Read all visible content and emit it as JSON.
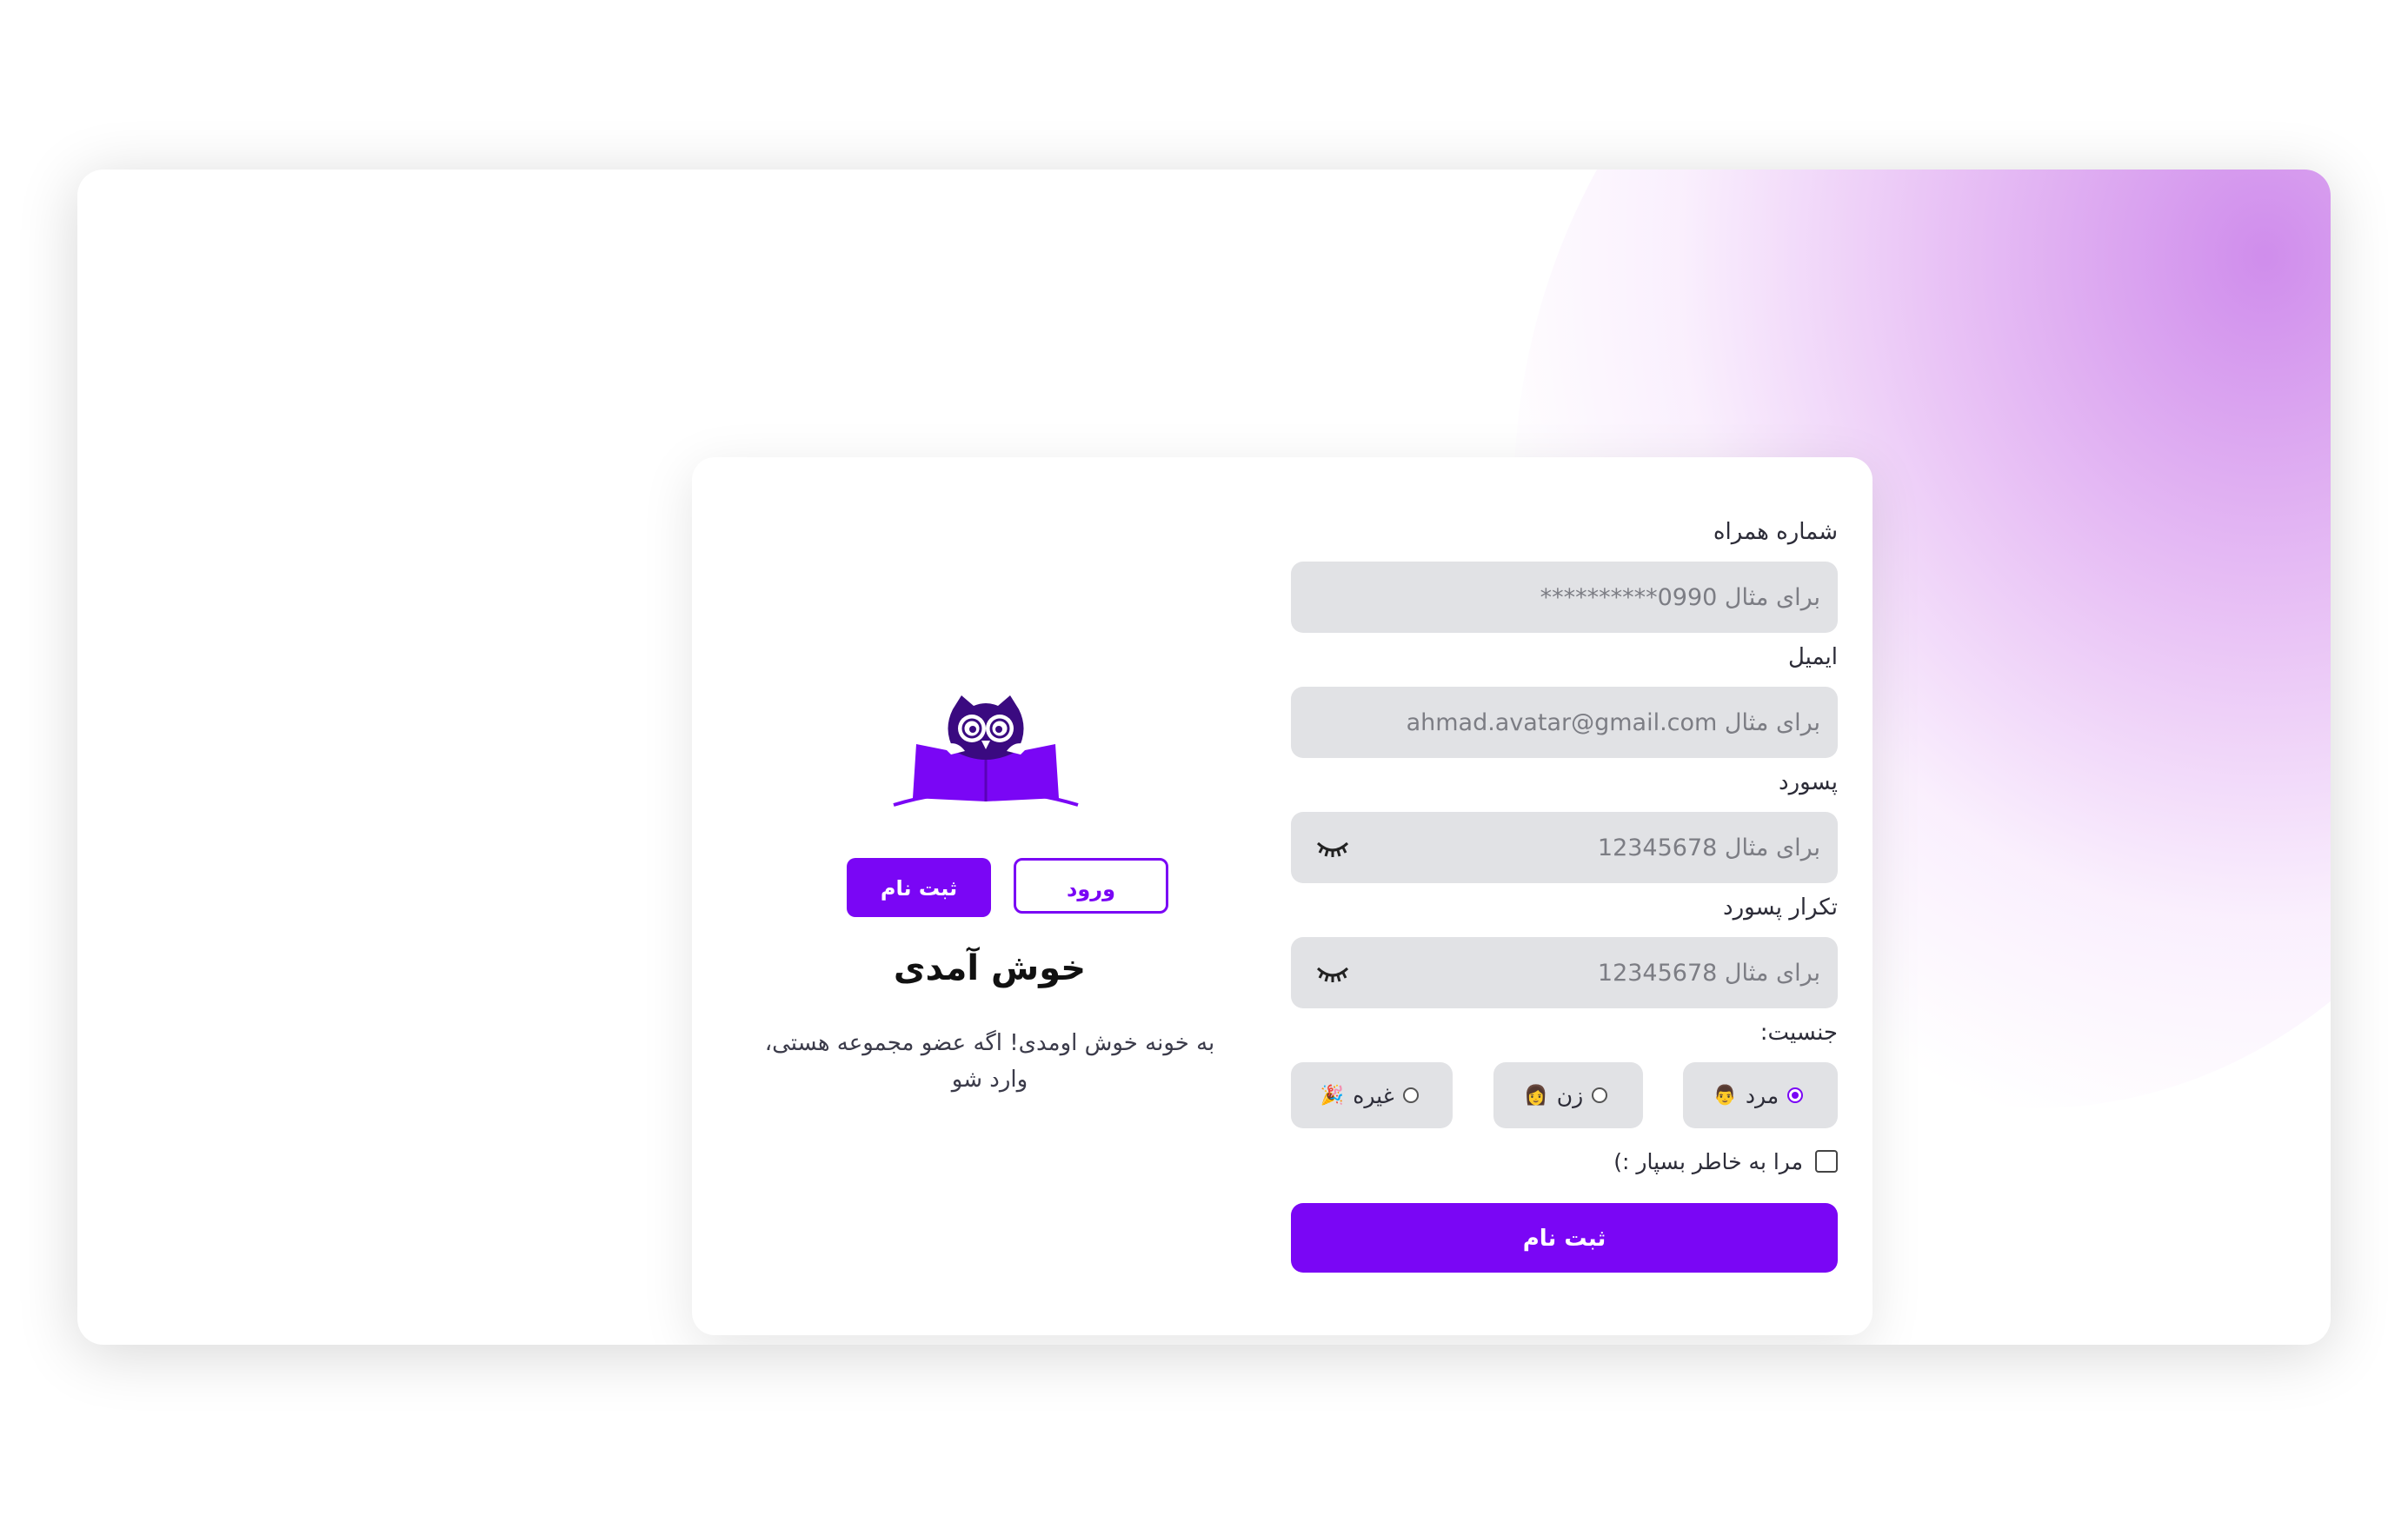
{
  "welcome": {
    "signup_button": "ثبت نام",
    "login_button": "ورود",
    "title": "خوش آمدی",
    "description": "به خونه خوش اومدی! اگه عضو مجموعه هستی، وارد شو"
  },
  "form": {
    "phone": {
      "label": "شماره همراه",
      "placeholder": "برای مثال 0990**********"
    },
    "email": {
      "label": "ایمیل",
      "placeholder": "برای مثال ahmad.avatar@gmail.com"
    },
    "password": {
      "label": "پسورد",
      "placeholder": "برای مثال 12345678"
    },
    "password_repeat": {
      "label": "تکرار پسورد",
      "placeholder": "برای مثال 12345678"
    },
    "gender": {
      "label": "جنسیت:",
      "options": [
        {
          "label": "مرد",
          "emoji": "👨",
          "selected": true
        },
        {
          "label": "زن",
          "emoji": "👩",
          "selected": false
        },
        {
          "label": "غیره",
          "emoji": "🎉",
          "selected": false
        }
      ]
    },
    "remember_me": {
      "label": "مرا به خاطر بسپار :)",
      "checked": false
    },
    "submit_label": "ثبت نام"
  },
  "colors": {
    "accent": "#7a06f5",
    "input_bg": "#e1e2e5"
  },
  "icons": {
    "logo": "owl-reading-book-icon",
    "password_toggle": "eye-closed-icon"
  }
}
